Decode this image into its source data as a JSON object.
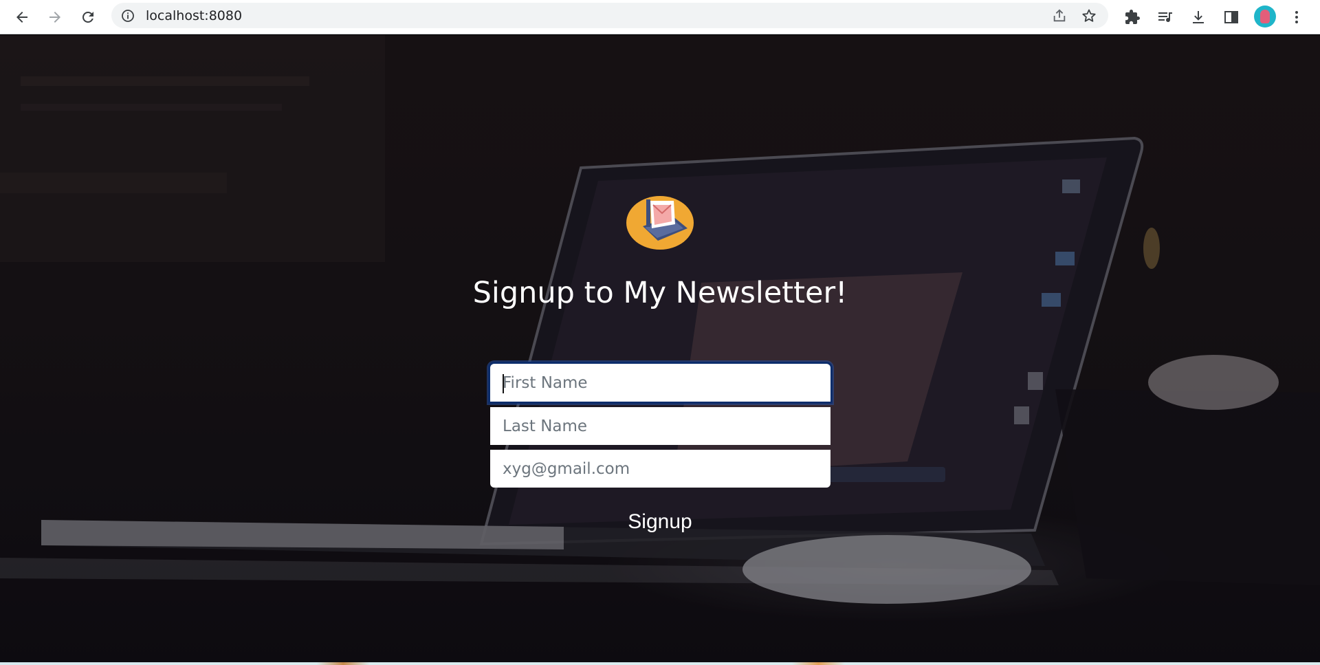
{
  "browser": {
    "url": "localhost:8080",
    "back_icon": "back-arrow-icon",
    "forward_icon": "forward-arrow-icon",
    "reload_icon": "reload-icon",
    "info_icon": "info-icon",
    "share_icon": "share-icon",
    "bookmark_icon": "star-icon",
    "extensions_icon": "puzzle-icon",
    "media_icon": "media-queue-icon",
    "downloads_icon": "download-icon",
    "sidepanel_icon": "side-panel-icon",
    "menu_icon": "kebab-menu-icon"
  },
  "signup": {
    "title": "Signup to My Newsletter!",
    "first_name_placeholder": "First Name",
    "last_name_placeholder": "Last Name",
    "email_placeholder": "xyg@gmail.com",
    "button_label": "Signup"
  },
  "colors": {
    "focus_ring": "#0d2d6b",
    "logo_circle": "#f0a833",
    "avatar": "#1fb5c9"
  }
}
